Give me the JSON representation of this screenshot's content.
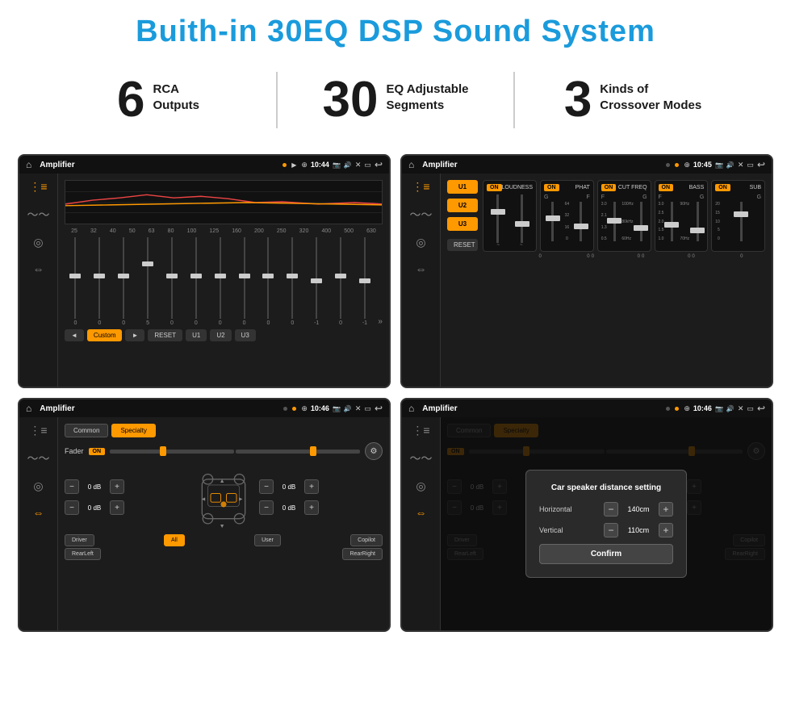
{
  "page": {
    "title": "Buith-in 30EQ DSP Sound System",
    "stats": [
      {
        "number": "6",
        "label": "RCA\nOutputs"
      },
      {
        "number": "30",
        "label": "EQ Adjustable\nSegments"
      },
      {
        "number": "3",
        "label": "Kinds of\nCrossover Modes"
      }
    ]
  },
  "screens": [
    {
      "id": "screen1",
      "title": "Amplifier",
      "time": "10:44",
      "type": "eq",
      "eq_labels": [
        "25",
        "32",
        "40",
        "50",
        "63",
        "80",
        "100",
        "125",
        "160",
        "200",
        "250",
        "320",
        "400",
        "500",
        "630"
      ],
      "eq_values": [
        0,
        0,
        0,
        5,
        0,
        0,
        0,
        0,
        0,
        0,
        -1,
        0,
        -1
      ],
      "preset": "Custom",
      "buttons": [
        "◄",
        "Custom",
        "►",
        "RESET",
        "U1",
        "U2",
        "U3"
      ]
    },
    {
      "id": "screen2",
      "title": "Amplifier",
      "time": "10:45",
      "type": "crossover",
      "presets": [
        "U1",
        "U2",
        "U3"
      ],
      "channels": [
        "LOUDNESS",
        "PHAT",
        "CUT FREQ",
        "BASS",
        "SUB"
      ],
      "reset_label": "RESET"
    },
    {
      "id": "screen3",
      "title": "Amplifier",
      "time": "10:46",
      "type": "fader",
      "tabs": [
        "Common",
        "Specialty"
      ],
      "fader_label": "Fader",
      "on_label": "ON",
      "speakers": {
        "fl": "0 dB",
        "fr": "0 dB",
        "rl": "0 dB",
        "rr": "0 dB"
      },
      "footer_buttons": [
        "Driver",
        "All",
        "User",
        "Copilot",
        "RearLeft",
        "RearRight"
      ]
    },
    {
      "id": "screen4",
      "title": "Amplifier",
      "time": "10:46",
      "type": "fader_dialog",
      "tabs": [
        "Common",
        "Specialty"
      ],
      "on_label": "ON",
      "dialog": {
        "title": "Car speaker distance setting",
        "horizontal_label": "Horizontal",
        "horizontal_value": "140cm",
        "vertical_label": "Vertical",
        "vertical_value": "110cm",
        "confirm_label": "Confirm"
      },
      "speakers": {
        "fl": "0 dB",
        "fr": "0 dB"
      },
      "footer_buttons": [
        "Driver",
        "Copilot",
        "RearLeft",
        "RearRight"
      ]
    }
  ],
  "icons": {
    "home": "⌂",
    "back": "↩",
    "eq_icon": "≡",
    "wave_icon": "〜",
    "speaker_icon": "◎",
    "arrows_icon": "⇔",
    "left_arrow": "◄",
    "right_arrow": "►",
    "pin_icon": "⊕",
    "camera_icon": "📷",
    "volume_icon": "🔊",
    "minus": "−",
    "plus": "+"
  }
}
